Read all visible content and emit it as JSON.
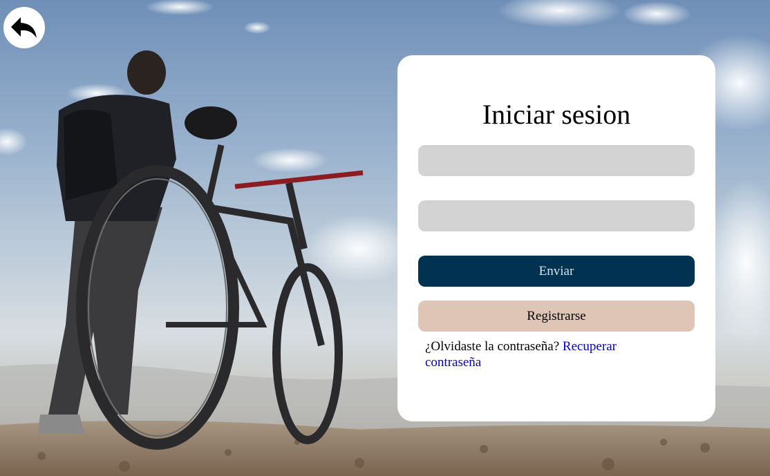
{
  "background": {
    "description_icon": "cyclist-with-bicycle-photo"
  },
  "back_button": {
    "icon": "reply-arrow-icon"
  },
  "login": {
    "title": "Iniciar sesion",
    "username_placeholder": "",
    "password_placeholder": "",
    "submit_label": "Enviar",
    "register_label": "Registrarse",
    "forgot_prefix": "¿Olvidaste la contraseña?",
    "recover_link": "Recuperar contraseña"
  },
  "colors": {
    "submit_bg": "#023252",
    "register_bg": "#dfc5b6",
    "input_bg": "#d3d3d3",
    "link": "#0000cc"
  }
}
